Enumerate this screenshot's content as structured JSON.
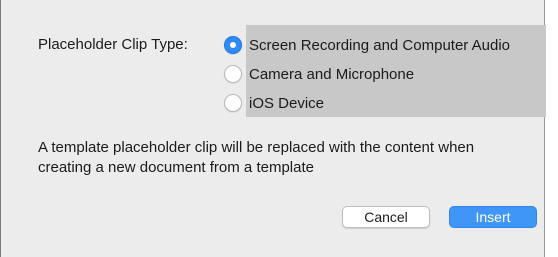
{
  "dialog": {
    "clip_type_label": "Placeholder Clip Type:",
    "options": [
      {
        "label": "Screen Recording and Computer Audio",
        "selected": true
      },
      {
        "label": "Camera and Microphone",
        "selected": false
      },
      {
        "label": "iOS Device",
        "selected": false
      }
    ],
    "description": "A template placeholder clip will be replaced with the content when creating a new document from a template",
    "buttons": {
      "cancel": "Cancel",
      "insert": "Insert"
    },
    "colors": {
      "accent": "#3f96f7",
      "highlight": "#c8c8c8",
      "background": "#ececec"
    }
  }
}
